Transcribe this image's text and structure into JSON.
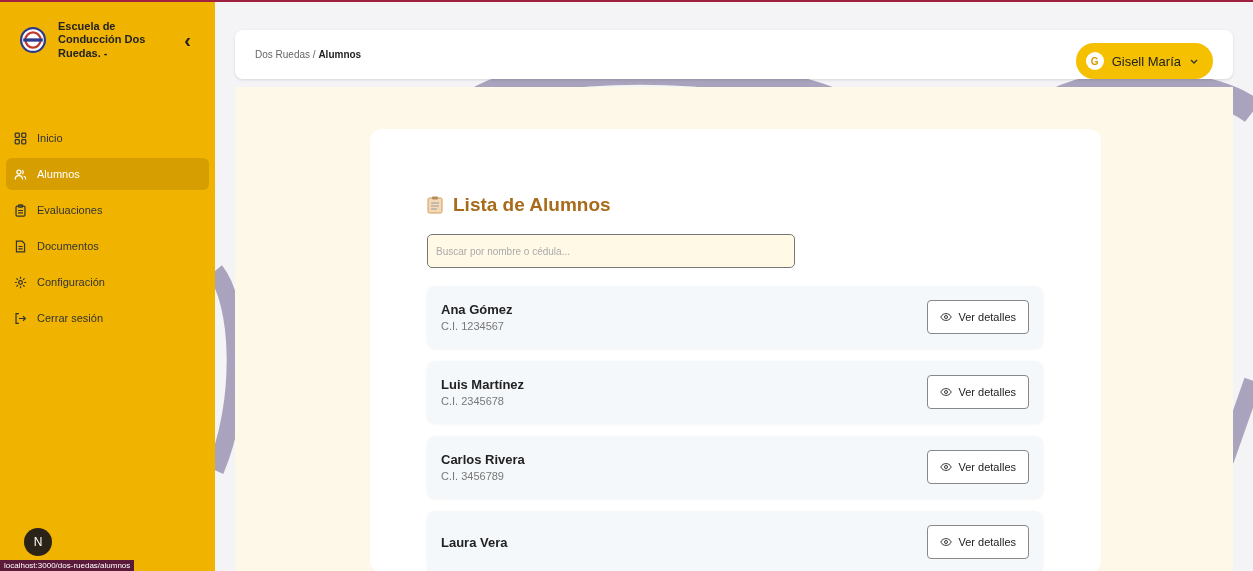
{
  "sidebar": {
    "brand": "Escuela de Conducción Dos Ruedas. -",
    "collapse_glyph": "‹",
    "items": [
      {
        "label": "Inicio",
        "kind": "grid",
        "selected": false
      },
      {
        "label": "Alumnos",
        "kind": "users",
        "selected": true
      },
      {
        "label": "Evaluaciones",
        "kind": "clipboard",
        "selected": false
      },
      {
        "label": "Documentos",
        "kind": "document",
        "selected": false
      },
      {
        "label": "Configuración",
        "kind": "gear",
        "selected": false
      },
      {
        "label": "Cerrar sesión",
        "kind": "logout",
        "selected": false
      }
    ],
    "dev_badge": "N",
    "status_url": "localhost:3000/dos-ruedas/alumnos"
  },
  "topbar": {
    "breadcrumb_parent": "Dos Ruedas /",
    "breadcrumb_current": "Alumnos",
    "user": {
      "initial": "G",
      "name": "Gisell María"
    }
  },
  "main": {
    "title": "Lista de Alumnos",
    "search": {
      "placeholder": "Buscar por nombre o cédula..."
    },
    "students": [
      {
        "name": "Ana Gómez",
        "ci": "C.I. 1234567",
        "action": "Ver detalles"
      },
      {
        "name": "Luis Martínez",
        "ci": "C.I. 2345678",
        "action": "Ver detalles"
      },
      {
        "name": "Carlos Rivera",
        "ci": "C.I. 3456789",
        "action": "Ver detalles"
      },
      {
        "name": "Laura Vera",
        "action": "Ver detalles"
      }
    ]
  }
}
